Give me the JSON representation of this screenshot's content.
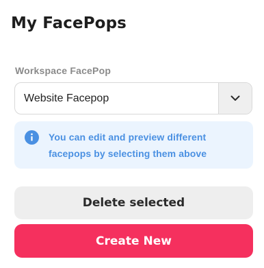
{
  "page": {
    "title": "My FacePops"
  },
  "workspace_select": {
    "label": "Workspace FacePop",
    "selected_value": "Website Facepop",
    "arrow_icon": "chevron-down-icon"
  },
  "info": {
    "icon": "info-icon",
    "text": "You can edit and preview different facepops by selecting them above",
    "color": "#4a90e2",
    "background": "#ebf4fe"
  },
  "actions": {
    "delete_label": "Delete selected",
    "create_label": "Create New",
    "create_color": "#f5305e"
  }
}
